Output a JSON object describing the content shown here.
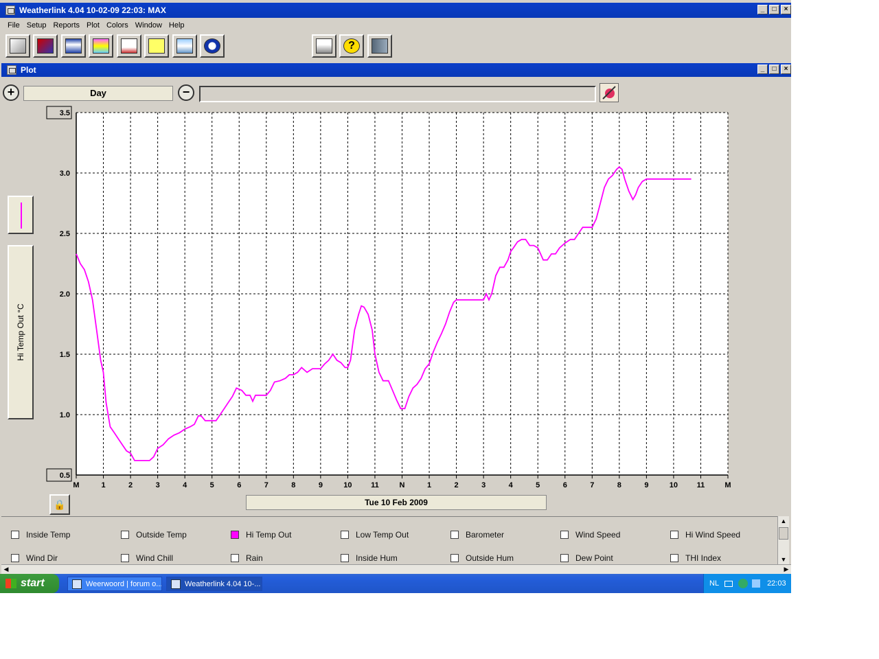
{
  "app": {
    "title": "Weatherlink 4.04  10-02-09  22:03: MAX",
    "menu": [
      "File",
      "Setup",
      "Reports",
      "Plot",
      "Colors",
      "Window",
      "Help"
    ]
  },
  "toolbar": {
    "buttons": [
      "station-icon",
      "download-icon",
      "bulletin-icon",
      "strip-chart-icon",
      "plot-icon",
      "notes-icon",
      "weather-icon",
      "noaa-icon",
      "print-icon",
      "help-icon",
      "exit-icon"
    ]
  },
  "plot_window": {
    "title": "Plot",
    "range_label": "Day",
    "date_label": "Tue 10 Feb 2009",
    "y_axis_title": "Hi Temp Out °C"
  },
  "chart_data": {
    "type": "line",
    "ylabel": "Hi Temp Out °C",
    "ylim": [
      0.5,
      3.5
    ],
    "yticks": [
      "3.5",
      "3.0",
      "2.5",
      "2.0",
      "1.5",
      "1.0",
      "0.5"
    ],
    "xticks": [
      "M",
      "1",
      "2",
      "3",
      "4",
      "5",
      "6",
      "7",
      "8",
      "9",
      "10",
      "11",
      "N",
      "1",
      "2",
      "3",
      "4",
      "5",
      "6",
      "7",
      "8",
      "9",
      "10",
      "11",
      "M"
    ],
    "xlim": [
      0,
      24
    ],
    "grid": true,
    "series": [
      {
        "name": "Hi Temp Out",
        "color": "#ff00ff",
        "x": [
          0,
          0.15,
          0.3,
          0.45,
          0.6,
          0.75,
          0.9,
          1.0,
          1.1,
          1.25,
          1.4,
          1.55,
          1.7,
          1.85,
          2.0,
          2.15,
          2.3,
          2.5,
          2.7,
          2.85,
          3.0,
          3.2,
          3.4,
          3.6,
          3.8,
          4.0,
          4.2,
          4.35,
          4.5,
          4.6,
          4.75,
          5.0,
          5.15,
          5.3,
          5.45,
          5.6,
          5.75,
          5.9,
          6.1,
          6.25,
          6.4,
          6.5,
          6.6,
          6.8,
          7.0,
          7.15,
          7.3,
          7.5,
          7.7,
          7.85,
          8.0,
          8.15,
          8.3,
          8.5,
          8.7,
          8.9,
          9.0,
          9.15,
          9.3,
          9.45,
          9.6,
          9.75,
          9.9,
          10.0,
          10.1,
          10.25,
          10.4,
          10.5,
          10.6,
          10.75,
          10.9,
          11.0,
          11.15,
          11.3,
          11.5,
          11.65,
          11.8,
          11.95,
          12.1,
          12.25,
          12.4,
          12.55,
          12.7,
          12.85,
          13.0,
          13.15,
          13.3,
          13.45,
          13.6,
          13.75,
          13.9,
          14.0,
          14.5,
          15.0,
          15.1,
          15.2,
          15.3,
          15.45,
          15.6,
          15.75,
          15.9,
          16.0,
          16.1,
          16.25,
          16.4,
          16.55,
          16.7,
          16.85,
          17.0,
          17.1,
          17.2,
          17.35,
          17.5,
          17.65,
          17.8,
          18.0,
          18.2,
          18.35,
          18.5,
          18.65,
          18.8,
          19.0,
          19.15,
          19.3,
          19.45,
          19.6,
          19.75,
          19.9,
          20.0,
          20.1,
          20.2,
          20.35,
          20.5,
          20.6,
          20.7,
          20.85,
          21.0,
          21.1,
          21.25,
          21.4,
          21.55,
          21.7,
          21.85,
          22.0,
          22.15,
          22.3,
          22.5,
          22.65
        ],
        "y": [
          2.33,
          2.25,
          2.2,
          2.1,
          1.95,
          1.7,
          1.45,
          1.35,
          1.1,
          0.9,
          0.85,
          0.8,
          0.75,
          0.7,
          0.68,
          0.62,
          0.62,
          0.62,
          0.62,
          0.65,
          0.72,
          0.75,
          0.8,
          0.83,
          0.85,
          0.88,
          0.9,
          0.92,
          0.99,
          0.99,
          0.95,
          0.95,
          0.95,
          1.0,
          1.05,
          1.1,
          1.15,
          1.22,
          1.2,
          1.16,
          1.16,
          1.11,
          1.16,
          1.16,
          1.16,
          1.2,
          1.27,
          1.28,
          1.3,
          1.33,
          1.33,
          1.35,
          1.39,
          1.35,
          1.38,
          1.38,
          1.38,
          1.42,
          1.45,
          1.5,
          1.45,
          1.43,
          1.39,
          1.39,
          1.45,
          1.7,
          1.83,
          1.9,
          1.89,
          1.83,
          1.7,
          1.5,
          1.35,
          1.28,
          1.28,
          1.2,
          1.12,
          1.05,
          1.05,
          1.15,
          1.22,
          1.25,
          1.3,
          1.38,
          1.42,
          1.52,
          1.6,
          1.67,
          1.75,
          1.85,
          1.93,
          1.95,
          1.95,
          1.95,
          2.0,
          1.95,
          2.0,
          2.15,
          2.22,
          2.22,
          2.28,
          2.35,
          2.38,
          2.43,
          2.45,
          2.45,
          2.4,
          2.4,
          2.38,
          2.33,
          2.28,
          2.28,
          2.33,
          2.33,
          2.38,
          2.42,
          2.45,
          2.45,
          2.5,
          2.55,
          2.55,
          2.55,
          2.62,
          2.75,
          2.88,
          2.95,
          2.98,
          3.03,
          3.05,
          3.03,
          2.95,
          2.85,
          2.78,
          2.82,
          2.88,
          2.93,
          2.95,
          2.95,
          2.95,
          2.95,
          2.95,
          2.95,
          2.95,
          2.95,
          2.95,
          2.95,
          2.95,
          2.95
        ]
      }
    ]
  },
  "series_panel": {
    "rows": [
      [
        {
          "label": "Inside Temp",
          "checked": false
        },
        {
          "label": "Outside Temp",
          "checked": false
        },
        {
          "label": "Hi Temp Out",
          "checked": true
        },
        {
          "label": "Low Temp Out",
          "checked": false
        },
        {
          "label": "Barometer",
          "checked": false
        },
        {
          "label": "Wind Speed",
          "checked": false
        },
        {
          "label": "Hi Wind Speed",
          "checked": false
        }
      ],
      [
        {
          "label": "Wind Dir",
          "checked": false
        },
        {
          "label": "Wind Chill",
          "checked": false
        },
        {
          "label": "Rain",
          "checked": false
        },
        {
          "label": "Inside Hum",
          "checked": false
        },
        {
          "label": "Outside Hum",
          "checked": false
        },
        {
          "label": "Dew Point",
          "checked": false
        },
        {
          "label": "THI Index",
          "checked": false
        }
      ]
    ]
  },
  "taskbar": {
    "start_label": "start",
    "items": [
      {
        "label": "Weerwoord | forum o...",
        "active": false
      },
      {
        "label": "Weatherlink 4.04  10-...",
        "active": true
      }
    ],
    "language": "NL",
    "clock": "22:03"
  }
}
